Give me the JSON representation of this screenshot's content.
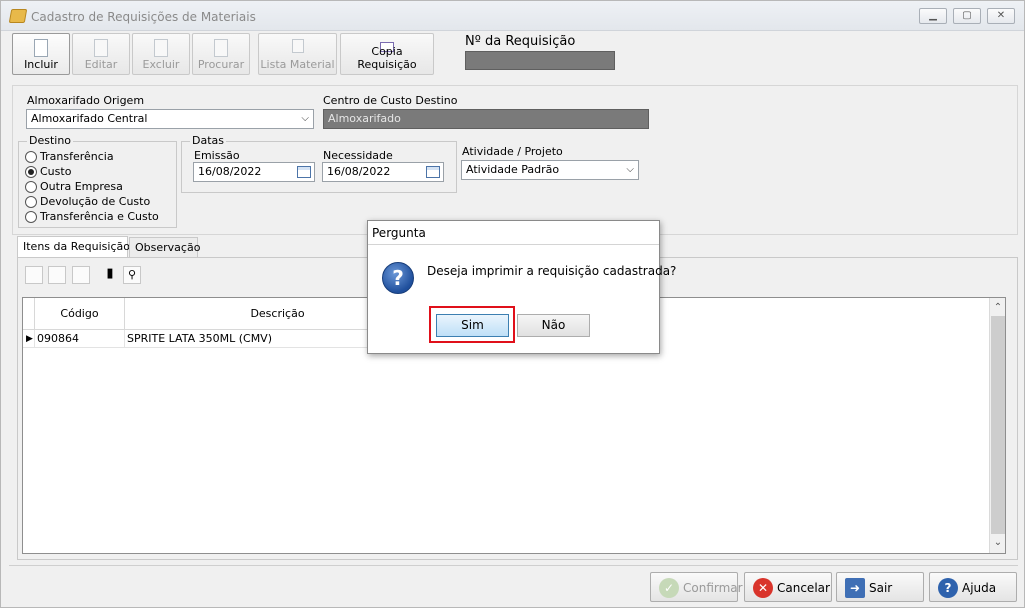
{
  "window": {
    "title": "Cadastro de Requisições de Materiais"
  },
  "toolbar": {
    "incluir": "Incluir",
    "editar": "Editar",
    "excluir": "Excluir",
    "procurar": "Procurar",
    "lista_material": "Lista Material",
    "copia_requisicao": "Copia Requisição"
  },
  "requisicao": {
    "label": "Nº da Requisição",
    "value": ""
  },
  "form": {
    "almox_origem_label": "Almoxarifado Origem",
    "almox_origem_value": "Almoxarifado Central",
    "centro_custo_label": "Centro de Custo Destino",
    "centro_custo_value": "Almoxarifado",
    "destino_label": "Destino",
    "destino_options": [
      "Transferência",
      "Custo",
      "Outra Empresa",
      "Devolução de Custo",
      "Transferência e Custo"
    ],
    "destino_selected": "Custo",
    "datas_label": "Datas",
    "emissao_label": "Emissão",
    "emissao_value": "16/08/2022",
    "necessidade_label": "Necessidade",
    "necessidade_value": "16/08/2022",
    "atividade_label": "Atividade / Projeto",
    "atividade_value": "Atividade Padrão"
  },
  "tabs": [
    "Itens da Requisição",
    "Observação"
  ],
  "grid": {
    "columns": [
      "Código",
      "Descrição"
    ],
    "rows": [
      {
        "codigo": "090864",
        "descricao": "SPRITE LATA 350ML (CMV)"
      }
    ]
  },
  "footer": {
    "confirmar": "Confirmar",
    "cancelar": "Cancelar",
    "sair": "Sair",
    "ajuda": "Ajuda"
  },
  "dialog": {
    "title": "Pergunta",
    "message": "Deseja imprimir a requisição cadastrada?",
    "yes": "Sim",
    "no": "Não"
  },
  "colors": {
    "highlight": "#e0101a",
    "disabled_field": "#7a7a7a",
    "dialog_icon": "#1f4f9c"
  }
}
